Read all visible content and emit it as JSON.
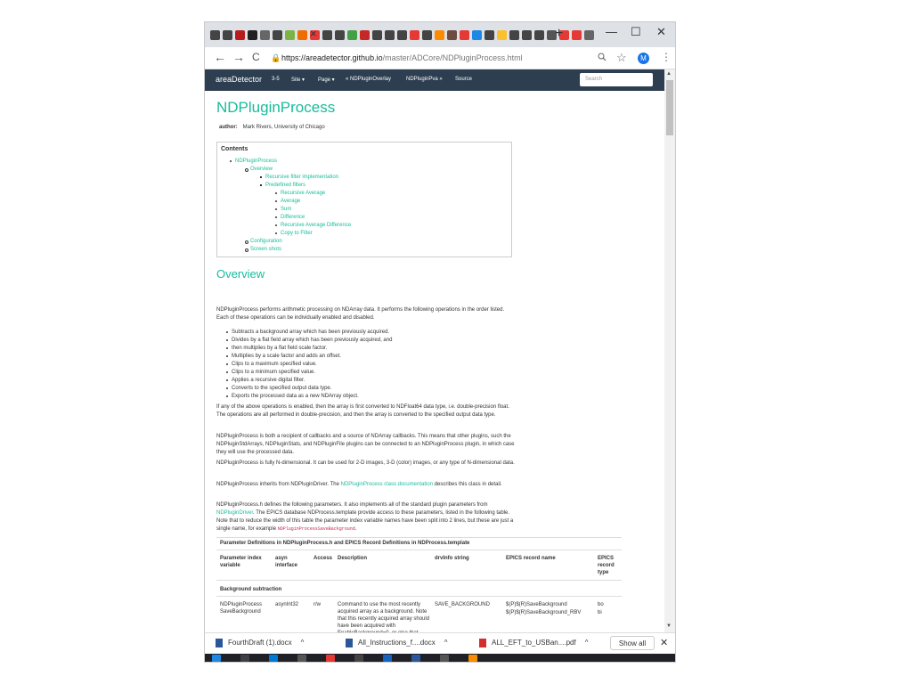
{
  "browser": {
    "tab_close": "×",
    "new_tab": "+",
    "win_minimize": "—",
    "win_maximize": "☐",
    "win_close": "✕",
    "favicon_colors_left": [
      "#444",
      "#444",
      "#b71c1c",
      "#222",
      "#666",
      "#444",
      "#7cb342",
      "#ef6c00",
      "#e53935"
    ],
    "favicon_colors_right": [
      "#444",
      "#444",
      "#43a047",
      "#c62828",
      "#444",
      "#444",
      "#444",
      "#e53935",
      "#444",
      "#fb8c00",
      "#6d4c41",
      "#e53935",
      "#1e88e5",
      "#444",
      "#fbc02d",
      "#444",
      "#444",
      "#444",
      "#555",
      "#e53935",
      "#e53935",
      "#666"
    ],
    "back": "←",
    "forward": "→",
    "reload": "C",
    "url_host": "https://areadetector.github.io",
    "url_path": "/master/ADCore/NDPluginProcess.html",
    "zoom_icon": "zoom-icon",
    "star": "☆",
    "avatar_letter": "M",
    "menu": "⋮"
  },
  "navbar": {
    "brand": "areaDetector",
    "version": "3-5",
    "site": "Site ▾",
    "page": "Page ▾",
    "overlay": "« NDPluginOverlay",
    "pva": "NDPluginPva »",
    "source": "Source",
    "search_placeholder": "Search"
  },
  "page": {
    "title": "NDPluginProcess",
    "author_label": "author:",
    "author_value": "Mark Rivers, University of Chicago",
    "contents_heading": "Contents",
    "toc": {
      "l1": "NDPluginProcess",
      "overview": "Overview",
      "recursive_impl": "Recursive filter implementation",
      "predefined": "Predefined filters",
      "rec_avg": "Recursive Average",
      "average": "Average",
      "sum": "Sum",
      "difference": "Difference",
      "rec_avg_diff": "Recursive Average Difference",
      "copy": "Copy to Filter",
      "configuration": "Configuration",
      "screenshots": "Screen shots"
    },
    "overview_heading": "Overview",
    "p1": "NDPluginProcess performs arithmetic processing on NDArray data. It performs the following operations in the order listed. Each of these operations can be individually enabled and disabled.",
    "bullets": [
      "Subtracts a background array which has been previously acquired.",
      "Divides by a flat field array which has been previously acquired, and",
      "then multiplies by a flat field scale factor.",
      "Multiplies by a scale factor and adds an offset.",
      "Clips to a maximum specified value.",
      "Clips to a minimum specified value.",
      "Applies a recursive digital filter.",
      "Converts to the specified output data type.",
      "Exports the processed data as a new NDArray object."
    ],
    "p2": "If any of the above operations is enabled, then the array is first converted to NDFloat64 data type, i.e. double-precision float. The operations are all performed in double-precision, and then the array is converted to the specified output data type.",
    "p3": "NDPluginProcess is both a recipient of callbacks and a source of NDArray callbacks. This means that other plugins, such the NDPluginStdArrays, NDPluginStats, and NDPluginFile plugins can be connected to an NDPluginProcess plugin, in which case they will use the processed data.",
    "p4": "NDPluginProcess is fully N-dimensional. It can be used for 2-D images, 3-D (color) images, or any type of N-dimensional data.",
    "p5_a": "NDPluginProcess inherits from NDPluginDriver. The ",
    "p5_link": "NDPluginProcess class documentation",
    "p5_b": " describes this class in detail.",
    "p6_a": "NDPluginProcess.h defines the following parameters. It also implements all of the standard plugin parameters from ",
    "p6_link": "NDPluginDriver",
    "p6_b": ". The EPICS database NDProcess.template provide access to these parameters, listed in the following table. Note that to reduce the width of this table the parameter index variable names have been split into 2 lines, but these are just a single name, for example ",
    "p6_code": "NDPluginProcessSaveBackground",
    "p6_c": "."
  },
  "table": {
    "caption": "Parameter Definitions in NDPluginProcess.h and EPICS Record Definitions in NDProcess.template",
    "headers": {
      "param": "Parameter index variable",
      "asyn": "asyn interface",
      "access": "Access",
      "desc": "Description",
      "drvinfo": "drvInfo string",
      "epics": "EPICS record name",
      "rtype": "EPICS record type"
    },
    "section": "Background subtraction",
    "row1": {
      "param": "NDPluginProcess SaveBackground",
      "asyn": "asynInt32",
      "access": "r/w",
      "desc": "Command to use the most recently acquired array as a background. Note that this recently acquired array should have been acquired with EnableBackground=0, or else that array will already have had the background subtracted, which is",
      "drvinfo": "SAVE_BACKGROUND",
      "epics1": "$(P)$(R)SaveBackground",
      "epics2": "$(P)$(R)SaveBackground_RBV",
      "rtype1": "bo",
      "rtype2": "bi"
    }
  },
  "downloads": {
    "d1": "FourthDraft (1).docx",
    "d2": "All_Instructions_f....docx",
    "d3": "ALL_EFT_to_USBan....pdf",
    "show_all": "Show all",
    "chevron": "^",
    "close": "✕"
  },
  "colors": {
    "accent": "#18bc9c",
    "navbar": "#2c3e50"
  }
}
